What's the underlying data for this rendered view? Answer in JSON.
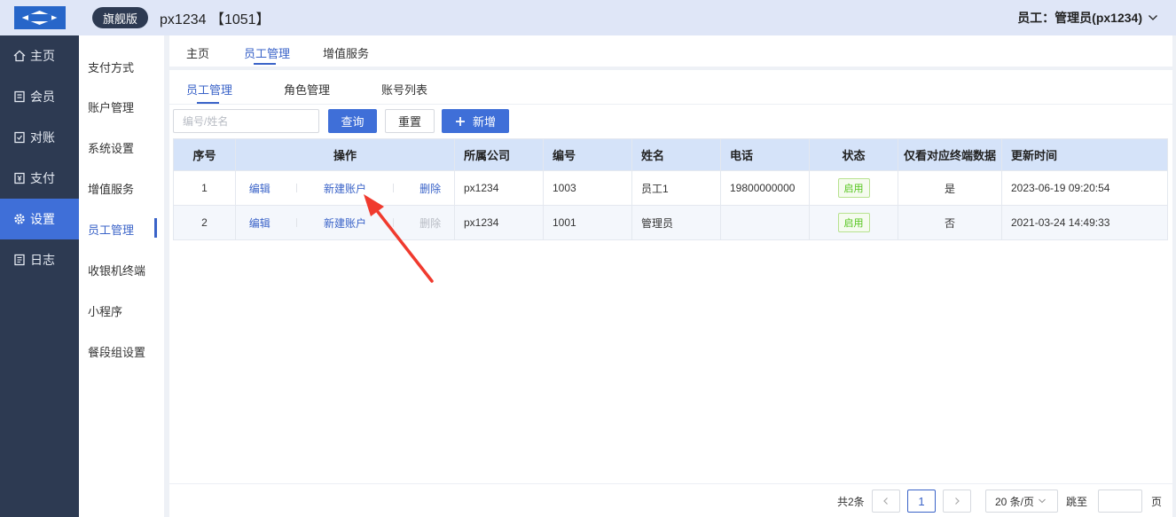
{
  "nav": {
    "items": [
      {
        "label": "主页",
        "icon": "home-icon"
      },
      {
        "label": "会员",
        "icon": "member-icon"
      },
      {
        "label": "对账",
        "icon": "reconcile-icon"
      },
      {
        "label": "支付",
        "icon": "pay-icon"
      },
      {
        "label": "设置",
        "icon": "gear-icon"
      },
      {
        "label": "日志",
        "icon": "log-icon"
      }
    ],
    "active": "设置"
  },
  "header": {
    "badge": "旗舰版",
    "title": "px1234 【1051】",
    "user": "员工：管理员(px1234)"
  },
  "subnav": {
    "items": [
      "支付方式",
      "账户管理",
      "系统设置",
      "增值服务",
      "员工管理",
      "收银机终端",
      "小程序",
      "餐段组设置"
    ],
    "active": "员工管理"
  },
  "page_tabs": {
    "items": [
      "主页",
      "员工管理",
      "增值服务"
    ],
    "active": "员工管理"
  },
  "inner_tabs": {
    "items": [
      "员工管理",
      "角色管理",
      "账号列表"
    ],
    "active": "员工管理"
  },
  "toolbar": {
    "search_placeholder": "编号/姓名",
    "query_label": "查询",
    "reset_label": "重置",
    "add_label": "新增",
    "add_icon": "plus-icon"
  },
  "table": {
    "headers": [
      "序号",
      "操作",
      "所属公司",
      "编号",
      "姓名",
      "电话",
      "状态",
      "仅看对应终端数据",
      "更新时间"
    ],
    "rows": [
      {
        "no": "1",
        "edit": "编辑",
        "new_account": "新建账户",
        "delete": "删除",
        "delete_disabled": false,
        "company": "px1234",
        "code": "1003",
        "name": "员工1",
        "phone": "19800000000",
        "status": "启用",
        "own_terminal": "是",
        "updated": "2023-06-19 09:20:54"
      },
      {
        "no": "2",
        "edit": "编辑",
        "new_account": "新建账户",
        "delete": "删除",
        "delete_disabled": true,
        "company": "px1234",
        "code": "1001",
        "name": "管理员",
        "phone": "",
        "status": "启用",
        "own_terminal": "否",
        "updated": "2021-03-24 14:49:33"
      }
    ]
  },
  "pagination": {
    "total": "共2条",
    "current_page": "1",
    "page_size": "20 条/页",
    "jump_label": "跳至",
    "page_unit": "页"
  },
  "colors": {
    "nav_bg": "#2d3a52",
    "accent": "#3f6fd8",
    "header_bg": "#dfe6f7",
    "table_head": "#d5e3f9",
    "status_green": "#52c41a",
    "annotation_arrow": "#f03a2e"
  }
}
